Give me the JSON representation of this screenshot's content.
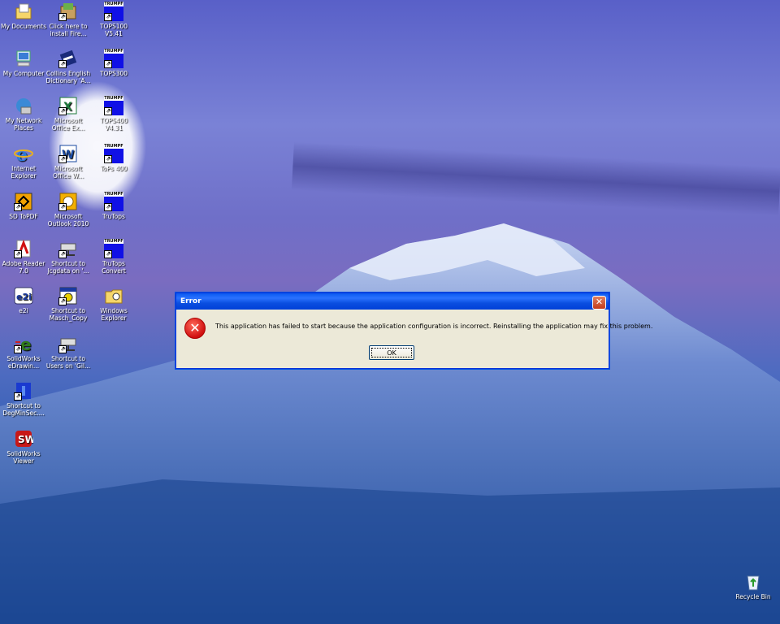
{
  "desktop": {
    "icons": [
      {
        "label": "My Documents",
        "icon": "my-documents-icon"
      },
      {
        "label": "Click here to install Fire...",
        "icon": "installer-box-icon"
      },
      {
        "label": "TOPS100 V5.41",
        "icon": "trumpf-icon"
      },
      {
        "label": "My Computer",
        "icon": "my-computer-icon"
      },
      {
        "label": "Collins English Dictionary 'A...",
        "icon": "collins-dictionary-icon"
      },
      {
        "label": "TOPS300",
        "icon": "trumpf-icon"
      },
      {
        "label": "My Network Places",
        "icon": "network-places-icon"
      },
      {
        "label": "Microsoft Office Ex...",
        "icon": "excel-icon"
      },
      {
        "label": "TOPS400 V4.31",
        "icon": "trumpf-icon"
      },
      {
        "label": "Internet Explorer",
        "icon": "internet-explorer-icon"
      },
      {
        "label": "Microsoft Office W...",
        "icon": "word-icon"
      },
      {
        "label": "ToPs 400",
        "icon": "trumpf-icon"
      },
      {
        "label": "SD ToPDF",
        "icon": "sd-topdf-icon"
      },
      {
        "label": "Microsoft Outlook 2010",
        "icon": "outlook-icon"
      },
      {
        "label": "TruTops",
        "icon": "trumpf-icon"
      },
      {
        "label": "Adobe Reader 7.0",
        "icon": "adobe-reader-icon"
      },
      {
        "label": "Shortcut to Jcgdata on '...",
        "icon": "network-drive-icon"
      },
      {
        "label": "TruTops Convert",
        "icon": "trumpf-icon"
      },
      {
        "label": "e2i",
        "icon": "e2i-icon"
      },
      {
        "label": "Shortcut to Masch_Copy",
        "icon": "folder-shortcut-icon"
      },
      {
        "label": "Windows Explorer",
        "icon": "windows-explorer-icon"
      },
      {
        "label": "SolidWorks eDrawin...",
        "icon": "edrawings-icon"
      },
      {
        "label": "Shortcut to Users on 'Gil...",
        "icon": "network-drive-icon"
      },
      {
        "label": "Shortcut to DegMinSec....",
        "icon": "degminsec-icon"
      },
      {
        "label": "SolidWorks Viewer",
        "icon": "solidworks-viewer-icon"
      }
    ],
    "recycle_bin": {
      "label": "Recycle Bin",
      "icon": "recycle-bin-icon"
    }
  },
  "dialog": {
    "title": "Error",
    "close_glyph": "✕",
    "icon": "error-icon",
    "message": "This application has failed to start because the application configuration is incorrect. Reinstalling the application may fix this problem.",
    "ok_label": "OK"
  }
}
